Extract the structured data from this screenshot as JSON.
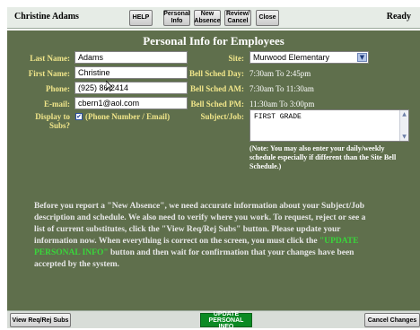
{
  "header": {
    "user_name": "Christine Adams",
    "status": "Ready",
    "buttons": {
      "help": "HELP",
      "personal_info": "Personal\nInfo",
      "new_absence": "New\nAbsence",
      "review_cancel": "Review/\nCancel",
      "close": "Close"
    }
  },
  "form": {
    "title": "Personal Info for Employees",
    "last_name_label": "Last Name:",
    "last_name_value": "Adams",
    "first_name_label": "First Name:",
    "first_name_value": "Christine",
    "phone_label": "Phone:",
    "phone_value": "(925) 86  2414",
    "email_label": "E-mail:",
    "email_value": "cbern1@aol.com",
    "display_label_1": "Display to",
    "display_label_2": "Subs?",
    "display_checked": "✔",
    "display_option": "(Phone Number / Email)",
    "site_label": "Site:",
    "site_value": "Murwood Elementary",
    "bell_day_label": "Bell Sched Day:",
    "bell_day_value": "7:30am To 2:45pm",
    "bell_am_label": "Bell Sched AM:",
    "bell_am_value": "7:30am To 11:30am",
    "bell_pm_label": "Bell Sched PM:",
    "bell_pm_value": "11:30am To 3:00pm",
    "subject_label": "Subject/Job:",
    "subject_value": "FIRST GRADE",
    "note": "(Note: You may also enter your daily/weekly schedule especially if different than the Site Bell Schedule.)",
    "instructions_before": "Before you report a \"New Absence\", we need accurate information about your Subject/Job description and schedule. We also need to verify where you work. To request, reject or see a list of current substitutes, click the \"View Req/Rej Subs\" button. Please update your information now. When everything is correct on the screen, you must click the",
    "instructions_highlight": " \"UPDATE PERSONAL INFO\" ",
    "instructions_after": "button and then wait for confirmation that your changes have been accepted by the system."
  },
  "footer": {
    "view_subs": "View Req/Rej Subs",
    "update": "UPDATE\nPERSONAL INFO",
    "cancel": "Cancel Changes"
  },
  "colors": {
    "panel": "#5f6f4c",
    "label": "#f1e68a",
    "update_button": "#0b8a24",
    "highlight": "#39d63b"
  }
}
